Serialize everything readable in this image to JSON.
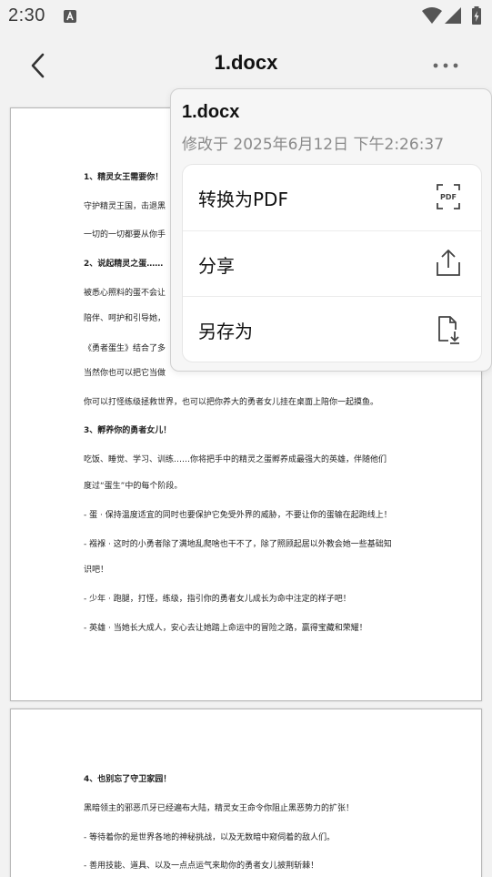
{
  "status_bar": {
    "time": "2:30",
    "icons": [
      "notification-a-icon",
      "wifi-icon",
      "signal-icon",
      "battery-charging-icon"
    ]
  },
  "toolbar": {
    "title": "1.docx",
    "back_icon": "back-arrow-icon",
    "more_icon": "more-dots-icon"
  },
  "document": {
    "page1_lines": [
      "1、精灵女王需要你！",
      "守护精灵王国，击退黑",
      "一切的一切都要从你手",
      "2、说起精灵之蛋……",
      "被悉心照料的蛋不会让",
      "陪伴、呵护和引导她，",
      "《勇者蛋生》结合了多",
      "当然你也可以把它当做",
      "你可以打怪练级拯救世界，也可以把你养大的勇者女儿挂在桌面上陪你一起摸鱼。",
      "3、孵养你的勇者女儿！",
      "吃饭、睡觉、学习、训练……你将把手中的精灵之蛋孵养成最强大的英雄，伴随他们",
      "度过“蛋生”中的每个阶段。",
      "- 蛋 · 保持温度适宜的同时也要保护它免受外界的威胁，不要让你的蛋输在起跑线上！",
      "- 襁褓 · 这时的小勇者除了满地乱爬啥也干不了，除了照顾起居以外教会她一些基础知",
      "识吧！",
      "- 少年 · 跑腿，打怪，练级，指引你的勇者女儿成长为命中注定的样子吧！",
      "- 英雄 · 当她长大成人，安心去让她踏上命运中的冒险之路，赢得宝藏和荣耀！"
    ],
    "page2_lines": [
      "4、也别忘了守卫家园！",
      "黑暗领主的邪恶爪牙已经遍布大陆，精灵女王命令你阻止黑恶势力的扩张！",
      "- 等待着你的是世界各地的神秘挑战，以及无数暗中窥伺着的敌人们。",
      "- 善用技能、道具、以及一点点运气来助你的勇者女儿披荆斩棘！"
    ]
  },
  "menu": {
    "title": "1.docx",
    "modified": "修改于 2025年6月12日 下午2:26:37",
    "items": [
      {
        "label": "转换为PDF",
        "icon": "pdf-convert-icon"
      },
      {
        "label": "分享",
        "icon": "share-upload-icon"
      },
      {
        "label": "另存为",
        "icon": "save-as-file-icon"
      }
    ]
  },
  "colors": {
    "background": "#f2f2f2",
    "page": "#ffffff",
    "menu_background": "#f6f6f6",
    "menu_card": "#ffffff",
    "subtitle_gray": "#8a8a8a"
  }
}
